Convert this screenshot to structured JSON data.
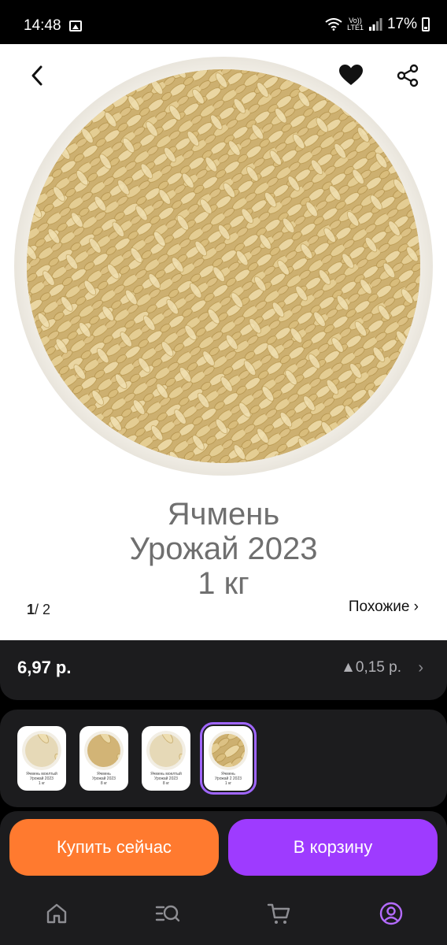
{
  "status": {
    "time": "14:48",
    "volte_top": "Vo))",
    "volte_bottom": "LTE1",
    "battery": "17%"
  },
  "product": {
    "title_line1": "Ячмень",
    "title_line2": "Урожай 2023",
    "title_line3": "1 кг",
    "pager_current": "1",
    "pager_total": "/ 2",
    "similar_label": "Похожие ›"
  },
  "price": {
    "value": "6,97 р.",
    "change": "▲0,15 р.",
    "chevron": "›"
  },
  "variants": [
    {
      "line1": "Ячмень моелтый",
      "line2": "Урожай 2023",
      "line3": "1 кг"
    },
    {
      "line1": "Ячмень",
      "line2": "Урожай 2023",
      "line3": "8 кг"
    },
    {
      "line1": "Ячмень моелтый",
      "line2": "Урожай 2023",
      "line3": "8 кг"
    },
    {
      "line1": "Ячмень",
      "line2": "Урожай 2 2023",
      "line3": "1 кг"
    }
  ],
  "actions": {
    "buy_label": "Купить сейчас",
    "cart_label": "В корзину"
  },
  "icons": {
    "back": "chevron-left-icon",
    "favorite": "heart-icon",
    "share": "share-icon",
    "home": "home-icon",
    "catalog": "catalog-search-icon",
    "cart": "cart-icon",
    "profile": "profile-icon"
  },
  "colors": {
    "buy": "#ff7a2f",
    "cart": "#9e3bff",
    "selected_variant": "#a066ff",
    "profile_active": "#b46bff"
  }
}
